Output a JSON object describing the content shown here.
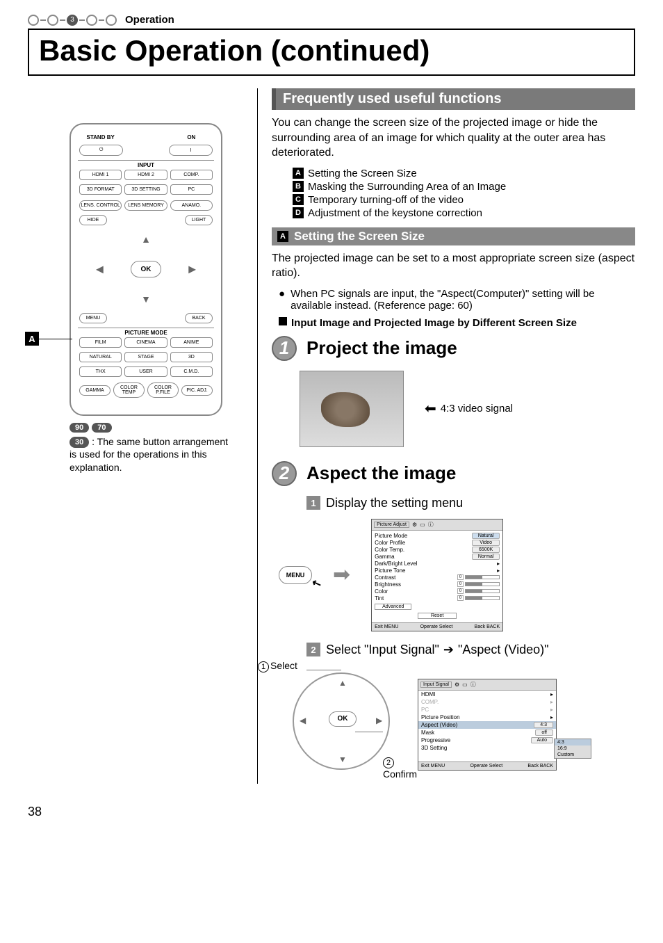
{
  "header": {
    "step_active": "3",
    "section_label": "Operation",
    "title": "Basic Operation (continued)"
  },
  "remote": {
    "standby": "STAND BY",
    "on": "ON",
    "input": "INPUT",
    "hdmi1": "HDMI 1",
    "hdmi2": "HDMI 2",
    "comp": "COMP.",
    "fmt3d": "3D FORMAT",
    "set3d": "3D SETTING",
    "pc": "PC",
    "lensctrl": "LENS. CONTROL",
    "lensmem": "LENS MEMORY",
    "anamo": "ANAMO.",
    "hide": "HIDE",
    "light": "LIGHT",
    "ok": "OK",
    "menu": "MENU",
    "back": "BACK",
    "picmode": "PICTURE MODE",
    "film": "FILM",
    "cinema": "CINEMA",
    "anime": "ANIME",
    "natural": "NATURAL",
    "stage": "STAGE",
    "m3d": "3D",
    "thx": "THX",
    "user": "USER",
    "cmd": "C.M.D.",
    "gamma": "GAMMA",
    "ctemp": "COLOR TEMP",
    "cpfile": "COLOR P.FILE",
    "picadj": "PIC. ADJ."
  },
  "left": {
    "ref1": "90",
    "ref2": "70",
    "ref3": "30",
    "note": " : The same button arrangement is used for the operations in this explanation."
  },
  "right": {
    "section": "Frequently used useful functions",
    "intro": "You can change the screen size of the projected image or hide the surrounding area of an image for which quality at the outer area has deteriorated.",
    "listA": "Setting the Screen Size",
    "listB": "Masking the Surrounding Area of an Image",
    "listC": "Temporary turning-off of the video",
    "listD": "Adjustment of the keystone correction",
    "subA": "Setting the Screen Size",
    "subA_text": "The projected image can be set to a most appropriate screen size (aspect ratio).",
    "subA_bullet": "When PC signals are input, the \"Aspect(Computer)\" setting will be available instead. (Reference page: 60)",
    "subA_bold": "Input Image and Projected Image by Different Screen Size",
    "step1": "Project the image",
    "vs_label": "4:3 video signal",
    "step2": "Aspect the image",
    "sub1": "Display the setting menu",
    "sub2_a": "Select \"Input Signal\"",
    "sub2_b": "\"Aspect (Video)\"",
    "menu_btn": "MENU",
    "sel_select": "Select",
    "sel_confirm": "Confirm",
    "sel_ok": "OK"
  },
  "osd1": {
    "tab": "Picture Adjust",
    "r1": "Picture Mode",
    "v1": "Natural",
    "r2": "Color Profile",
    "v2": "Video",
    "r3": "Color Temp.",
    "v3": "6500K",
    "r4": "Gamma",
    "v4": "Normal",
    "r5": "Dark/Bright Level",
    "r6": "Picture Tone",
    "r7": "Contrast",
    "n7": "0",
    "r8": "Brightness",
    "n8": "0",
    "r9": "Color",
    "n9": "0",
    "r10": "Tint",
    "n10": "0",
    "adv": "Advanced",
    "reset": "Reset",
    "exit": "Exit",
    "fmenu": "MENU",
    "operate": "Operate",
    "select": "Select",
    "back": "Back",
    "fback": "BACK"
  },
  "osd2": {
    "tab": "Input Signal",
    "r1": "HDMI",
    "r2": "COMP.",
    "r3": "PC",
    "r4": "Picture Position",
    "r5": "Aspect (Video)",
    "v5": "4:3",
    "r6": "Mask",
    "v6": "off",
    "r7": "Progressive",
    "v7": "Auto",
    "r8": "3D Setting",
    "exit": "Exit",
    "fmenu": "MENU",
    "operate": "Operate",
    "select": "Select",
    "back": "Back",
    "fback": "BACK",
    "p1": "4:3",
    "p2": "16:9",
    "p3": "Custom"
  },
  "page_number": "38"
}
